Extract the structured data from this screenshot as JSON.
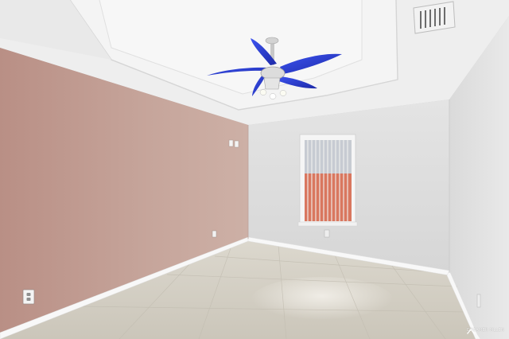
{
  "watermark": {
    "text": "DREAMER MLLEN",
    "logo_icon": "house-roof-icon"
  },
  "colors": {
    "accent_wall": "#c3a096",
    "neutral_wall": "#dcdcdc",
    "ceiling": "#f1f1f1",
    "floor_tile": "#d7d3c8",
    "baseboard": "#f7f7f7",
    "fan_blade": "#2b3ed6",
    "window_view": "#d9775f"
  }
}
